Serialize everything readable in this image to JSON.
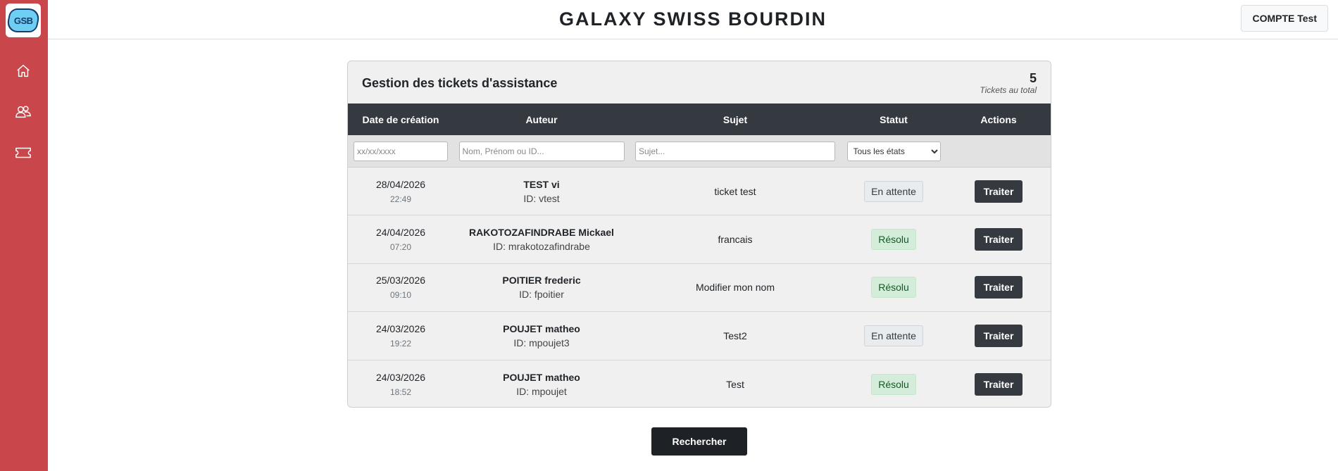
{
  "app": {
    "brand": "GALAXY SWISS BOURDIN",
    "logo_text": "GSB",
    "account_label": "COMPTE Test",
    "sidebar_icons": [
      "home-icon",
      "users-icon",
      "ticket-icon"
    ],
    "colors": {
      "sidebar": "#c9474b",
      "dark": "#343a40",
      "resolu_bg": "#d4edda",
      "attente_bg": "#e9ecef"
    }
  },
  "card": {
    "title": "Gestion des tickets d'assistance",
    "total": "5",
    "total_label": "Tickets au total"
  },
  "table": {
    "headers": [
      "Date de création",
      "Auteur",
      "Sujet",
      "Statut",
      "Actions"
    ],
    "filters": {
      "date_placeholder": "xx/xx/xxxx",
      "author_placeholder": "Nom, Prénom ou ID...",
      "subject_placeholder": "Sujet...",
      "status_selected": "Tous les états"
    },
    "rows": [
      {
        "date": "28/04/2026",
        "time": "22:49",
        "author": "TEST vi",
        "author_id": "ID: vtest",
        "subject": "ticket test",
        "status": "En attente",
        "action": "Traiter"
      },
      {
        "date": "24/04/2026",
        "time": "07:20",
        "author": "RAKOTOZAFINDRABE Mickael",
        "author_id": "ID: mrakotozafindrabe",
        "subject": "francais",
        "status": "Résolu",
        "action": "Traiter"
      },
      {
        "date": "25/03/2026",
        "time": "09:10",
        "author": "POITIER frederic",
        "author_id": "ID: fpoitier",
        "subject": "Modifier mon nom",
        "status": "Résolu",
        "action": "Traiter"
      },
      {
        "date": "24/03/2026",
        "time": "19:22",
        "author": "POUJET matheo",
        "author_id": "ID: mpoujet3",
        "subject": "Test2",
        "status": "En attente",
        "action": "Traiter"
      },
      {
        "date": "24/03/2026",
        "time": "18:52",
        "author": "POUJET matheo",
        "author_id": "ID: mpoujet",
        "subject": "Test",
        "status": "Résolu",
        "action": "Traiter"
      }
    ]
  },
  "search_button": "Rechercher"
}
